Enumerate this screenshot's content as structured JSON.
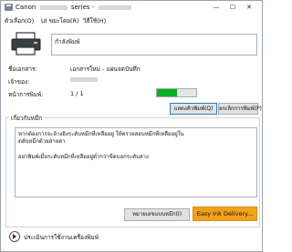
{
  "window": {
    "title_brand": "Canon",
    "title_suffix": "series -",
    "minimize": "—",
    "maximize": "☐",
    "close": "✕"
  },
  "menu": [
    {
      "label": "ตัวเลือก(O)"
    },
    {
      "label": "UI ขยะโดย(R)"
    },
    {
      "label": "วิธีใช้(H)"
    }
  ],
  "status": {
    "message": "กำลังพิมพ์"
  },
  "info": {
    "document_label": "ชื่อเอกสาร:",
    "document_value": "เอกสารใหม่ - แผ่นจดบันทึก",
    "owner_label": "เจ้าของ:",
    "pages_label": "หน้าการพิมพ์:",
    "pages_value": "1 / 1",
    "progress_percent": 50
  },
  "buttons": {
    "show_queue": "แสดงคิวพิมพ์(Q)",
    "cancel_print": "ยกเลิกการพิมพ์(P)",
    "ink_model": "หมายเลขแบบหมึก(I)",
    "easy_ink": "Easy Ink Delivery..."
  },
  "ink_group": {
    "title": "เกี่ยวกับหมึก",
    "line1": "หากต้องการจะอ้างอิงระดับหมึกที่เหลืออยู่ ให้ตรวจสอบหมึกที่เหลืออยู่ในตลับหมึกด้วยสายตา",
    "line2": "อย่าพิมพ์เมื่อระดับหมึกที่เหลืออยู่ต่ำกว่าขีดบอกระดับล่าง"
  },
  "footer": {
    "label": "ประเมินการใช้งานเครื่องพิมพ์"
  }
}
